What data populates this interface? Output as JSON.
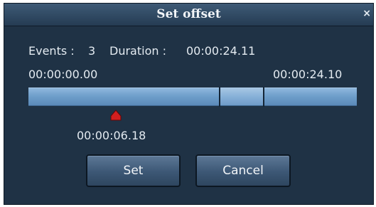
{
  "dialog": {
    "title": "Set offset",
    "close_glyph": "×"
  },
  "info": {
    "events_label": "Events :",
    "events_value": "3",
    "duration_label": "Duration :",
    "duration_value": "00:00:24.11"
  },
  "timeline": {
    "start_time": "00:00:00.00",
    "end_time": "00:00:24.10",
    "cursor_time": "00:00:06.18",
    "cursor_position_fraction": 0.26
  },
  "buttons": {
    "set_label": "Set",
    "cancel_label": "Cancel"
  },
  "colors": {
    "dialog_bg": "#1f3245",
    "timeline": "#6f9fcb",
    "cursor": "#d21f1f"
  }
}
